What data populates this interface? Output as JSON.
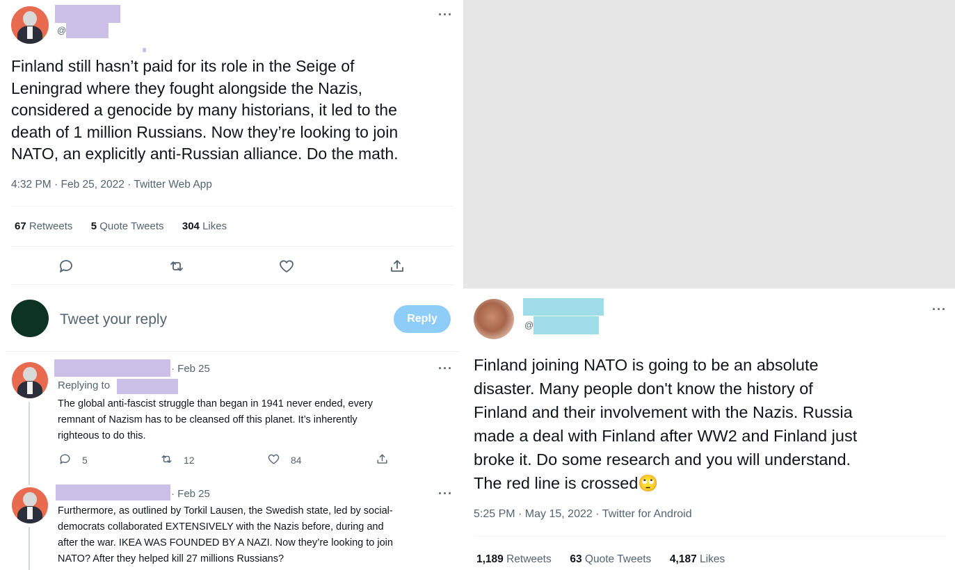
{
  "colors": {
    "redact_purple": "#cbbfe8",
    "redact_blue": "#9fdcea",
    "gray_panel": "#e6e6e6",
    "reply_button": "#8ecdf8"
  },
  "main_tweet": {
    "handle_prefix": "@",
    "text_lines": [
      "Finland still hasn’t paid for its role in the Seige of",
      "Leningrad where they fought alongside the Nazis,",
      "considered a genocide by many historians, it led to the",
      "death of 1 million Russians. Now they’re looking to join",
      "NATO, an explicitly anti-Russian alliance. Do the math."
    ],
    "meta": "4:32 PM · Feb 25, 2022 · Twitter Web App",
    "retweets": "67",
    "retweets_label": "Retweets",
    "quotes": "5",
    "quotes_label": "Quote Tweets",
    "likes": "304",
    "likes_label": "Likes",
    "more_icon": "more-dots-icon"
  },
  "compose": {
    "placeholder": "Tweet your reply",
    "button": "Reply"
  },
  "reply1": {
    "date": "· Feb 25",
    "replying_to": "Replying to",
    "text_lines": [
      "The global anti-fascist struggle than began in 1941 never ended, every",
      "remnant of Nazism has to be cleansed off this planet. It’s inherently",
      "righteous to do this."
    ],
    "replies": "5",
    "retweets": "12",
    "likes": "84"
  },
  "reply2": {
    "date": "· Feb 25",
    "text_lines": [
      "Furthermore, as outlined by Torkil Lausen, the Swedish state, led by social-",
      "democrats collaborated EXTENSIVELY with the Nazis before, during and",
      "after the war. IKEA WAS FOUNDED BY A NAZI. Now they’re looking to join",
      "NATO? After they helped kill 27 millions Russians?"
    ]
  },
  "second_tweet": {
    "handle_prefix": "@",
    "text_lines": [
      "Finland joining NATO is going to be an absolute",
      "disaster. Many people don't know the history of",
      "Finland and their involvement with the Nazis. Russia",
      "made a deal with Finland after WW2 and Finland just",
      "broke it. Do some research and you will understand.",
      "The red line is crossed"
    ],
    "emoji": "🙄",
    "meta": "5:25 PM · May 15, 2022 · Twitter for Android",
    "retweets": "1,189",
    "retweets_label": "Retweets",
    "quotes": "63",
    "quotes_label": "Quote Tweets",
    "likes": "4,187",
    "likes_label": "Likes"
  }
}
